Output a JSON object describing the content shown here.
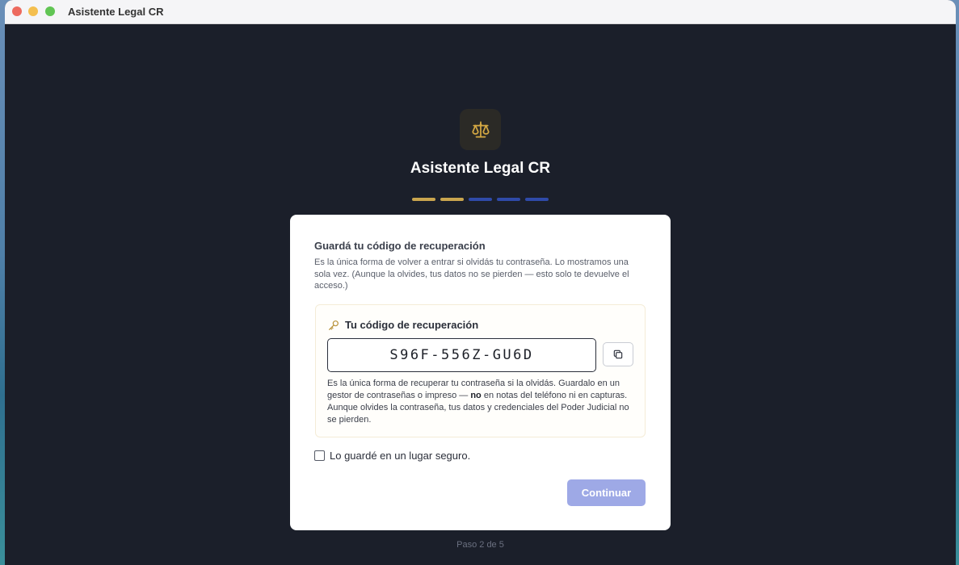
{
  "window": {
    "title": "Asistente Legal CR"
  },
  "app": {
    "logo_icon": "scales-icon",
    "title": "Asistente Legal CR"
  },
  "progress": {
    "current_step": 2,
    "total_steps": 5,
    "label": "Paso 2 de 5"
  },
  "card": {
    "heading": "Guardá tu código de recuperación",
    "description": "Es la única forma de volver a entrar si olvidás tu contraseña. Lo mostramos una sola vez. (Aunque la olvides, tus datos no se pierden — esto solo te devuelve el acceso.)",
    "code_section": {
      "icon": "key-icon",
      "label": "Tu código de recuperación",
      "code": "S96F-556Z-GU6D",
      "copy_icon": "copy-icon",
      "note_part1": "Es la única forma de recuperar tu contraseña si la olvidás. Guardalo en un gestor de contraseñas o impreso — ",
      "note_bold": "no",
      "note_part2": " en notas del teléfono ni en capturas. Aunque olvides la contraseña, tus datos y credenciales del Poder Judicial no se pierden."
    },
    "confirm_label": "Lo guardé en un lugar seguro.",
    "confirm_checked": false,
    "continue_label": "Continuar"
  },
  "colors": {
    "window_bg": "#1b1f2a",
    "accent_gold": "#c9a54e",
    "step_pending": "#2f4aa8",
    "button_disabled": "#9ea9e6"
  }
}
